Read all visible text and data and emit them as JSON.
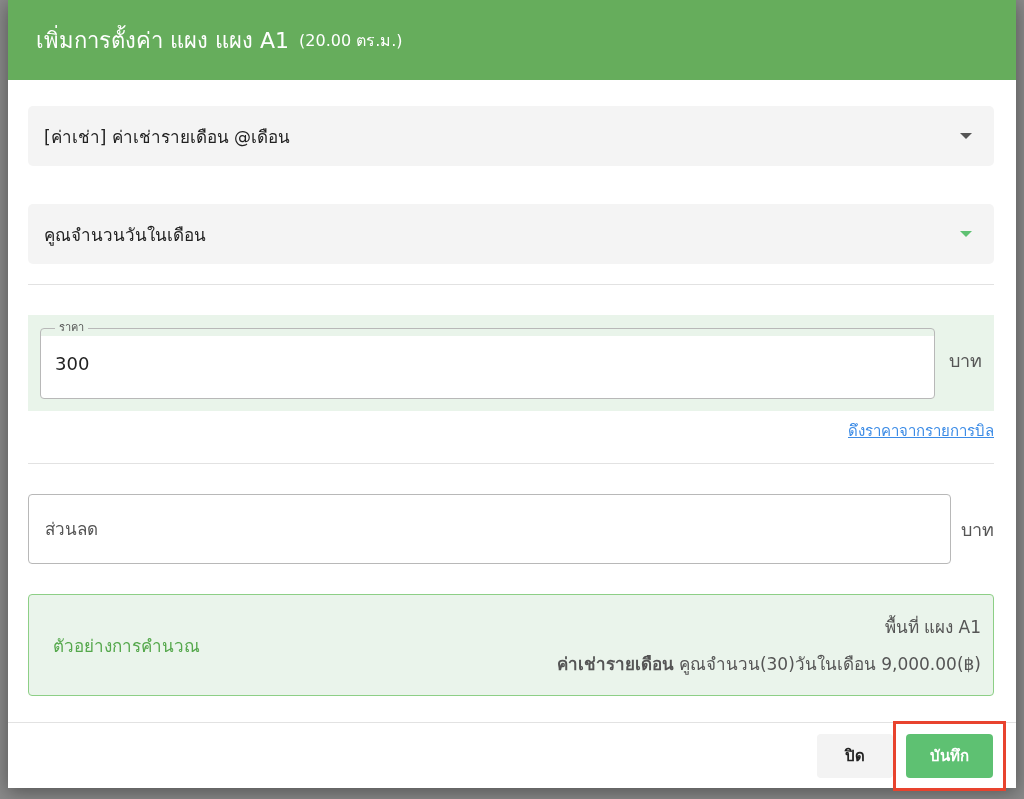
{
  "dialog": {
    "title": "เพิ่มการตั้งค่า แผง แผง A1",
    "subtitle": "(20.00 ตร.ม.)"
  },
  "selects": [
    {
      "value": "[ค่าเช่า] ค่าเช่ารายเดือน @เดือน",
      "active": false
    },
    {
      "value": "คูณจำนวนวันในเดือน",
      "active": true
    }
  ],
  "price": {
    "label": "ราคา",
    "value": "300",
    "unit": "บาท",
    "link": "ดึงราคาจากรายการบิล"
  },
  "discount": {
    "placeholder": "ส่วนลด",
    "unit": "บาท"
  },
  "example": {
    "title": "ตัวอย่างการคำนวณ",
    "lines": [
      "พื้นที่ แผง A1",
      "**ค่าเช่ารายเดือน** คูณจำนวน(30)วันในเดือน 9,000.00(฿)"
    ]
  },
  "buttons": [
    {
      "label": "ปิด",
      "kind": "secondary",
      "highlighted": false
    },
    {
      "label": "บันทึก",
      "kind": "primary",
      "highlighted": true
    }
  ]
}
